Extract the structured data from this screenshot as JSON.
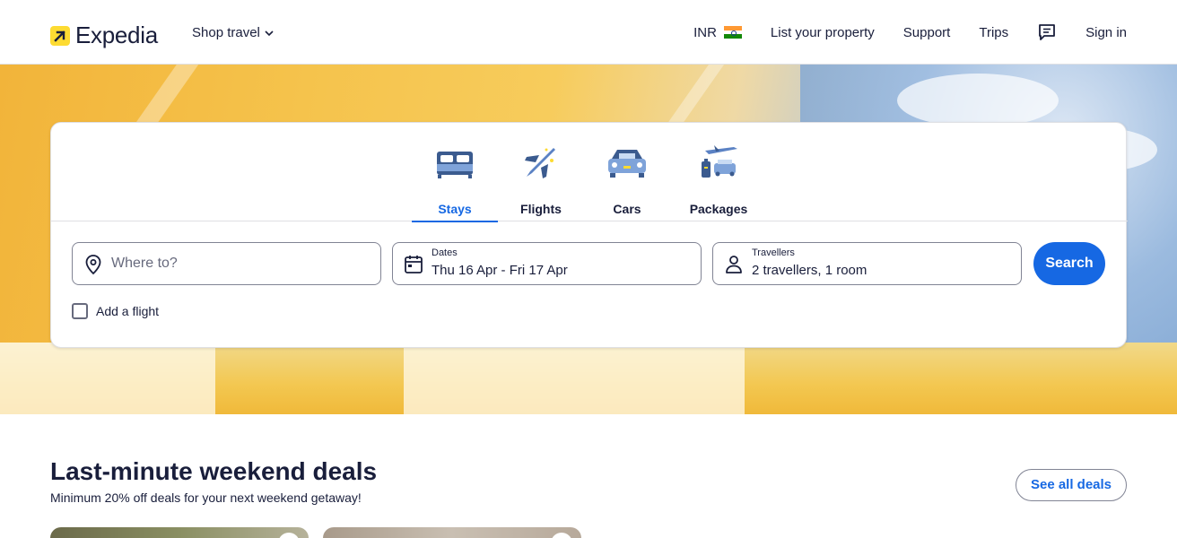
{
  "brand": {
    "name": "Expedia",
    "logo_color": "#fddb32"
  },
  "header": {
    "shop_travel": "Shop travel",
    "currency": "INR",
    "list_property": "List your property",
    "support": "Support",
    "trips": "Trips",
    "messages_icon": "chat-icon",
    "sign_in": "Sign in"
  },
  "search": {
    "tabs": [
      {
        "label": "Stays",
        "icon": "bed-icon",
        "active": true
      },
      {
        "label": "Flights",
        "icon": "plane-icon",
        "active": false
      },
      {
        "label": "Cars",
        "icon": "car-icon",
        "active": false
      },
      {
        "label": "Packages",
        "icon": "packages-icon",
        "active": false
      }
    ],
    "destination": {
      "placeholder": "Where to?",
      "icon": "location-pin-icon"
    },
    "dates": {
      "label": "Dates",
      "value": "Thu 16 Apr - Fri 17 Apr",
      "icon": "calendar-icon"
    },
    "travellers": {
      "label": "Travellers",
      "value": "2 travellers, 1 room",
      "icon": "person-icon"
    },
    "search_button": "Search",
    "add_flight": "Add a flight",
    "accent_color": "#1668e3"
  },
  "deals": {
    "title": "Last-minute weekend deals",
    "subtitle": "Minimum 20% off deals for your next weekend getaway!",
    "see_all": "See all deals"
  }
}
